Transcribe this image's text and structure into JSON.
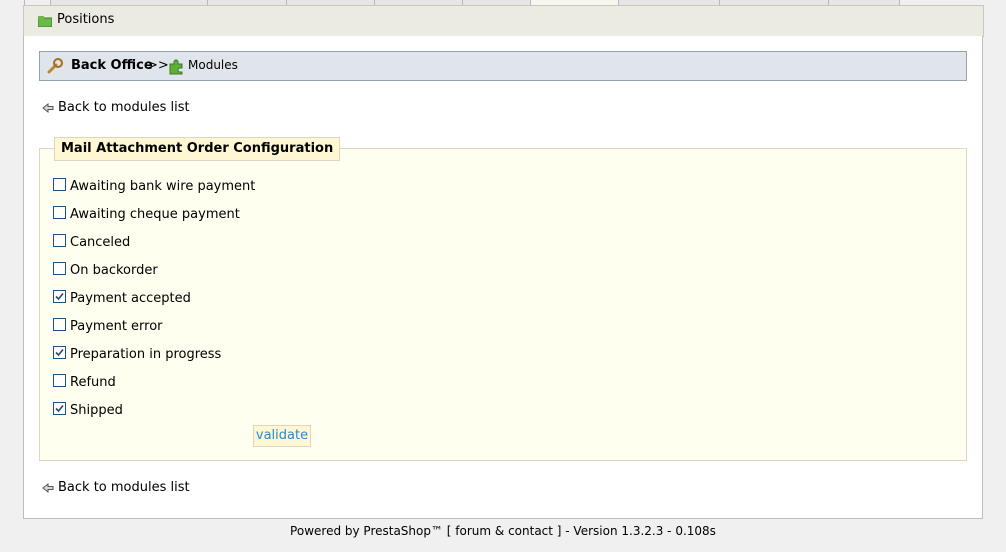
{
  "submenu": {
    "label": "Positions"
  },
  "breadcrumb": {
    "root": "Back Office",
    "separator": ">>",
    "current": "Modules"
  },
  "back_link": "Back to modules list",
  "form": {
    "legend": "Mail Attachment Order Configuration",
    "options": [
      {
        "label": "Awaiting bank wire payment",
        "checked": false
      },
      {
        "label": "Awaiting cheque payment",
        "checked": false
      },
      {
        "label": "Canceled",
        "checked": false
      },
      {
        "label": "On backorder",
        "checked": false
      },
      {
        "label": "Payment accepted",
        "checked": true
      },
      {
        "label": "Payment error",
        "checked": false
      },
      {
        "label": "Preparation in progress",
        "checked": true
      },
      {
        "label": "Refund",
        "checked": false
      },
      {
        "label": "Shipped",
        "checked": true
      }
    ],
    "submit_label": "validate"
  },
  "footer": "Powered by PrestaShop™ [ forum & contact ] - Version 1.3.2.3 - 0.108s"
}
